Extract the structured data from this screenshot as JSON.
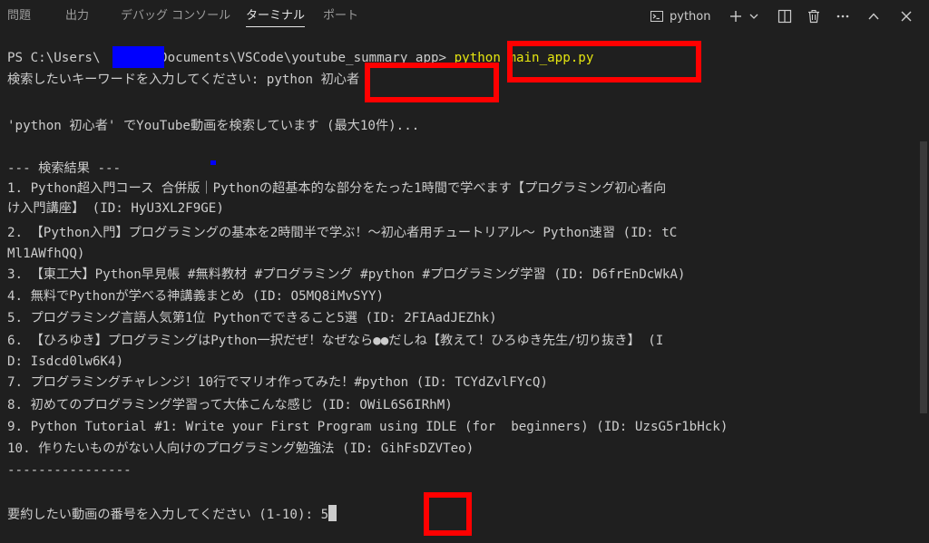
{
  "panel_tabs": [
    "問題",
    "出力",
    "デバッグ コンソール",
    "ターミナル",
    "ポート"
  ],
  "toolbar": {
    "terminal_label": "python",
    "icons": [
      "terminal-icon",
      "plus-icon",
      "chevron-down-icon",
      "split-icon",
      "trash-icon",
      "more-icon",
      "chevron-up-icon",
      "close-icon"
    ]
  },
  "terminal": {
    "prompt_before": "PS C:\\Users\\",
    "prompt_after": "\\Documents\\VSCode\\youtube_summary_app> ",
    "command": "python main_app.py",
    "input_prompt": "検索したいキーワードを入力してください: ",
    "keyword": "python 初心者",
    "searching": "'python 初心者' でYouTube動画を検索しています (最大10件)...",
    "results_header": "--- 検索結果 ---",
    "result_lines": [
      "1. Python超入門コース 合併版｜Pythonの超基本的な部分をたった1時間で学べます【プログラミング初心者向",
      "け入門講座】 (ID: HyU3XL2F9GE)",
      "2. 【Python入門】プログラミングの基本を2時間半で学ぶ！〜初心者用チュートリアル〜 Python速習 (ID: tC",
      "Ml1AWfhQQ)",
      "3. 【東工大】Python早見帳 #無料教材 #プログラミング #python #プログラミング学習 (ID: D6frEnDcWkA)",
      "4. 無料でPythonが学べる神講義まとめ (ID: O5MQ8iMvSYY)",
      "5. プログラミング言語人気第1位 Pythonでできること5選 (ID: 2FIAadJEZhk)",
      "6. 【ひろゆき】プログラミングはPython一択だぜ！なぜなら●●だしね【教えて！ひろゆき先生/切り抜き】 (I",
      "D: Isdcd0lw6K4)",
      "7. プログラミングチャレンジ！10行でマリオ作ってみた！#python (ID: TCYdZvlFYcQ)",
      "8. 初めてのプログラミング学習って大体こんな感じ (ID: OWiL6S6IRhM)",
      "9. Python Tutorial #1: Write your First Program using IDLE (for  beginners) (ID: UzsG5r1bHck)",
      "10. 作りたいものがない人向けのプログラミング勉強法 (ID: GihFsDZVTeo)"
    ],
    "separator": "----------------",
    "selection_prompt": "要約したい動画の番号を入力してください (1-10): ",
    "selection_value": "5"
  },
  "colors": {
    "background": "#1f1f1f",
    "text": "#cccccc",
    "command": "#e5e510",
    "highlight_box": "#ff0000",
    "redaction": "#0000ff"
  }
}
